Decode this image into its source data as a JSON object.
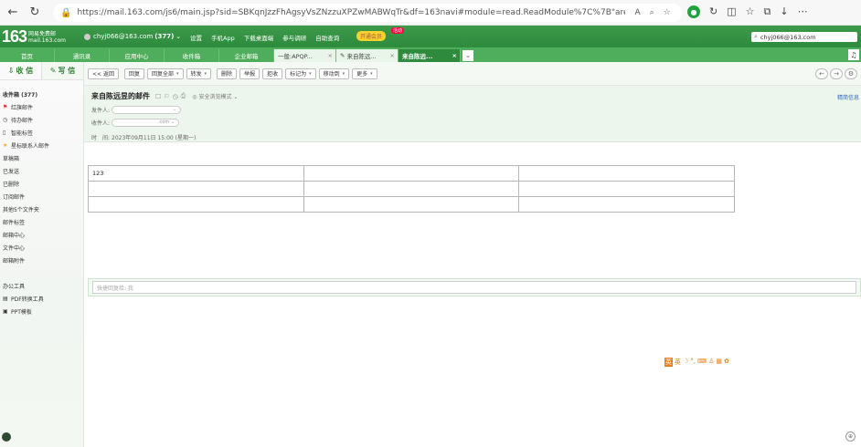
{
  "browser": {
    "url": "https://mail.163.com/js6/main.jsp?sid=SBKqnJzzFhAgsyVsZNzzuXPZwMABWqTr&df=163navi#module=read.ReadModule%7C%7B\"area\"%3A\"normal\"...",
    "icons": [
      "back-arrow-icon",
      "refresh-icon",
      "lock-icon",
      "read-aloud-icon",
      "zoom-icon",
      "favorite-icon"
    ]
  },
  "header": {
    "logo_num": "163",
    "logo_name": "网易免费邮",
    "logo_domain": "mail.163.com",
    "account": "chyj066@163.com",
    "unread": "(377)",
    "links": [
      "设置",
      "手机App",
      "下载桌面端",
      "参与调研",
      "自助查询"
    ],
    "promo": "开通会员",
    "promo_badge": "活动",
    "search_value": "chyj066@163.com"
  },
  "tabs": [
    {
      "label": "首页",
      "kind": "fixed"
    },
    {
      "label": "通讯录",
      "kind": "fixed"
    },
    {
      "label": "应用中心",
      "kind": "fixed"
    },
    {
      "label": "收件箱",
      "kind": "fixed"
    },
    {
      "label": "企业邮箱",
      "kind": "fixed"
    },
    {
      "label": "一般:APQP...",
      "kind": "doc"
    },
    {
      "label": "来自陈远...",
      "kind": "doc"
    },
    {
      "label": "来自陈远...",
      "kind": "active"
    }
  ],
  "sidebar": {
    "receive": "收 信",
    "write": "写 信",
    "items": [
      {
        "label": "收件箱 (377)",
        "icon": "",
        "bold": true
      },
      {
        "label": "红旗邮件",
        "icon": "flag-icon"
      },
      {
        "label": "待办邮件",
        "icon": "clock-icon"
      },
      {
        "label": "智能标签",
        "icon": "tag-icon"
      },
      {
        "label": "星标联系人邮件",
        "icon": "star-icon"
      },
      {
        "label": "草稿箱",
        "icon": ""
      },
      {
        "label": "已发送",
        "icon": ""
      },
      {
        "label": "已删除",
        "icon": ""
      },
      {
        "label": "订阅邮件",
        "icon": ""
      },
      {
        "label": "其他5个文件夹",
        "icon": ""
      },
      {
        "label": "邮件标签",
        "icon": ""
      },
      {
        "label": "邮箱中心",
        "icon": ""
      },
      {
        "label": "文件中心",
        "icon": ""
      },
      {
        "label": "邮箱附件",
        "icon": ""
      }
    ],
    "office_title": "办公工具",
    "office_items": [
      {
        "label": "PDF转换工具",
        "icon": "pdf-icon"
      },
      {
        "label": "PPT模板",
        "icon": "ppt-icon"
      }
    ]
  },
  "toolbar": {
    "buttons": [
      {
        "label": "<< 返回",
        "dropdown": false
      },
      {
        "label": "回复",
        "dropdown": false
      },
      {
        "label": "回复全部",
        "dropdown": true
      },
      {
        "label": "转发",
        "dropdown": true
      },
      {
        "label": "删除",
        "dropdown": false
      },
      {
        "label": "举报",
        "dropdown": false
      },
      {
        "label": "拒收",
        "dropdown": false
      },
      {
        "label": "标记为",
        "dropdown": true
      },
      {
        "label": "移动到",
        "dropdown": true
      },
      {
        "label": "更多",
        "dropdown": true
      }
    ]
  },
  "mail": {
    "subject": "来自陈远昱的邮件",
    "safe_mode": "安全浏览模式",
    "right_link": "精简信息",
    "sender_label": "发件人:",
    "receiver_label": "收件人:",
    "receiver_suffix": ".com",
    "time_label": "时　间:",
    "time_value": "2023年09月11日 15:00 (星期一)"
  },
  "table": {
    "rows": [
      [
        "123",
        "",
        ""
      ],
      [
        "",
        "",
        ""
      ],
      [
        "",
        "",
        ""
      ]
    ]
  },
  "reply": {
    "placeholder": "快捷回复给: 我"
  }
}
